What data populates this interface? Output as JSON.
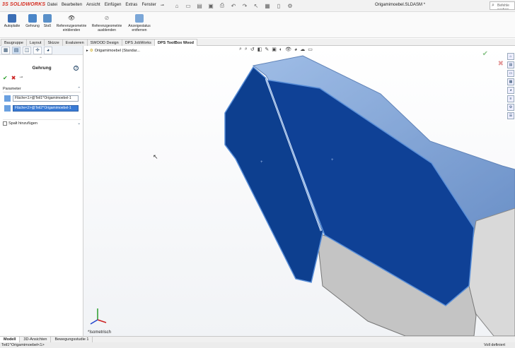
{
  "app": {
    "logo_text": "SOLIDWORKS",
    "doc_title": "Origamimoebel.SLDASM *",
    "search_placeholder": "Befehle suchen"
  },
  "menu": [
    "Datei",
    "Bearbeiten",
    "Ansicht",
    "Einfügen",
    "Extras",
    "Fenster"
  ],
  "ribbon": [
    {
      "label": "Autoplatte",
      "icon": "autoplate-icon",
      "color": "#3c6fb6"
    },
    {
      "label": "Gehrung",
      "icon": "miter-icon",
      "color": "#4b86c8"
    },
    {
      "label": "Stoß",
      "icon": "joint-icon",
      "color": "#5a90c9"
    },
    {
      "label": "Referenzgeometrie einblenden",
      "icon": "show-reference-icon",
      "color": "#3a3a3a"
    },
    {
      "label": "Referenzgeometrie ausblenden",
      "icon": "hide-reference-icon",
      "color": "#8a8a8a"
    },
    {
      "label": "Anzeigestatus entfernen",
      "icon": "display-state-icon",
      "color": "#7ba7d8"
    }
  ],
  "tabs": [
    "Baugruppe",
    "Layout",
    "Skizze",
    "Evaluieren",
    "SWOOD Design",
    "DPS JobWorks",
    "DPS ToolBox Wood"
  ],
  "active_tab": "DPS ToolBox Wood",
  "panel": {
    "title": "Gehrung",
    "section": "Parameter",
    "face1": "Fläche<1>@Teil1^Origamimoebel-1",
    "face2": "Fläche<2>@Teil2^Origamimoebel-1",
    "checkbox_label": "Spalt hinzufügen"
  },
  "tree_root": "Origamimoebel (Standar...",
  "view_label": "*Isometrisch",
  "bottom_tabs": [
    "Modell",
    "3D-Ansichten",
    "Bewegungsstudie 1"
  ],
  "status": {
    "left": "Teil1^Origamimoebel<1>",
    "right": "Voll definiert"
  },
  "colors": {
    "face_blue": "#0d3f8f",
    "glass_blue": "#5f8fd0",
    "accent_red": "#d52b1e"
  }
}
